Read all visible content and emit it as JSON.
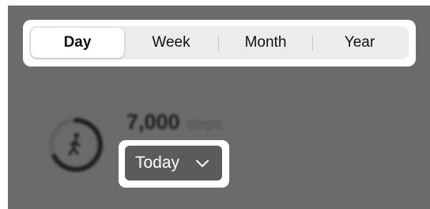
{
  "segmented_control": {
    "items": [
      {
        "label": "Day",
        "selected": true
      },
      {
        "label": "Week",
        "selected": false
      },
      {
        "label": "Month",
        "selected": false
      },
      {
        "label": "Year",
        "selected": false
      }
    ]
  },
  "activity": {
    "steps_count": "7,000",
    "steps_unit": "steps",
    "icon": "walking-person-icon"
  },
  "date_filter": {
    "label": "Today",
    "icon": "chevron-down-icon"
  },
  "colors": {
    "overlay": "#6b6b6b",
    "segment_bg": "#ececec",
    "button_bg": "#5b5b5b"
  }
}
